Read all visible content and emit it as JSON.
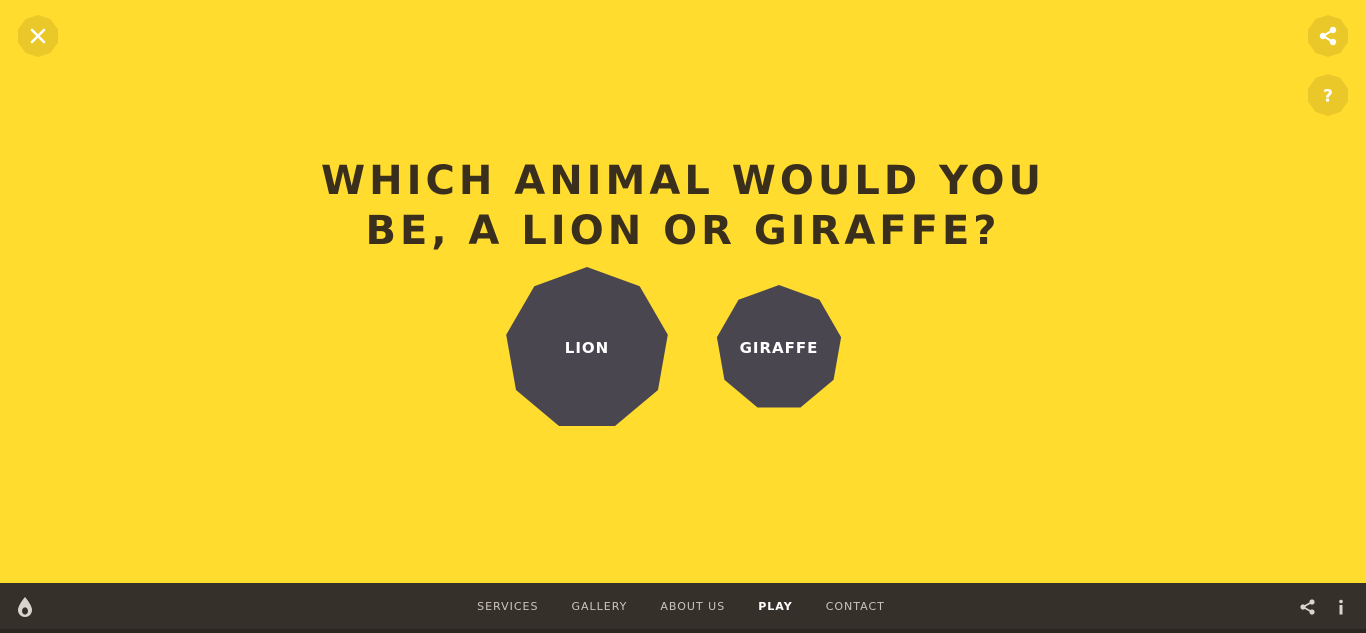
{
  "page": {
    "question_line1": "WHICH ANIMAL WOULD YOU",
    "question_line2": "BE, A LION OR GIRAFFE?"
  },
  "choices": [
    {
      "label": "LION"
    },
    {
      "label": "GIRAFFE"
    }
  ],
  "footer": {
    "nav": [
      {
        "label": "SERVICES"
      },
      {
        "label": "GALLERY"
      },
      {
        "label": "ABOUT US"
      },
      {
        "label": "PLAY",
        "active": true
      },
      {
        "label": "CONTACT"
      }
    ]
  },
  "icons": {
    "top_left": "close-icon",
    "top_right": "share-icon",
    "top_right_secondary": "help-icon",
    "footer_logo": "drop-logo-icon",
    "footer_right": [
      "share-icon",
      "info-icon"
    ]
  },
  "colors": {
    "background": "#ffdc2e",
    "heading": "#3a2f1c",
    "choice_fill": "#4a4650",
    "corner_button": "#eac829",
    "footer": "#36302a"
  }
}
